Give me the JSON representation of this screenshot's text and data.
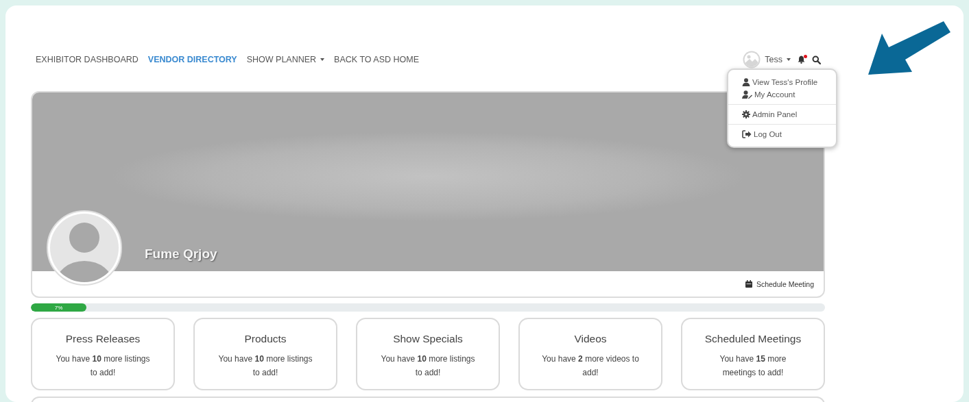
{
  "nav": [
    {
      "label": "EXHIBITOR DASHBOARD",
      "selected": false,
      "has_menu": false
    },
    {
      "label": "VENDOR DIRECTORY",
      "selected": true,
      "has_menu": false
    },
    {
      "label": "SHOW PLANNER",
      "selected": false,
      "has_menu": true
    },
    {
      "label": "BACK TO ASD HOME",
      "selected": false,
      "has_menu": false
    }
  ],
  "user": {
    "name": "Tess",
    "has_notifications": true
  },
  "user_menu": [
    [
      {
        "label": "View Tess's Profile",
        "kind": "profile"
      },
      {
        "label": "My Account",
        "kind": "account"
      }
    ],
    [
      {
        "label": "Admin Panel",
        "kind": "admin"
      }
    ],
    [
      {
        "label": "Log Out",
        "kind": "logout"
      }
    ]
  ],
  "profile": {
    "name": "Fume Qrjoy",
    "action": "Schedule Meeting"
  },
  "progress": {
    "level": 0.07,
    "label": "7%"
  },
  "cards": [
    {
      "title": "Press Releases",
      "text": "You have **10** more listings to add!"
    },
    {
      "title": "Products",
      "text": "You have **10** more listings to add!"
    },
    {
      "title": "Show Specials",
      "text": "You have **10** more listings to add!"
    },
    {
      "title": "Videos",
      "text": "You have **2** more videos to add!"
    },
    {
      "title": "Scheduled Meetings",
      "text": "You have **15** more meetings to add!"
    }
  ]
}
